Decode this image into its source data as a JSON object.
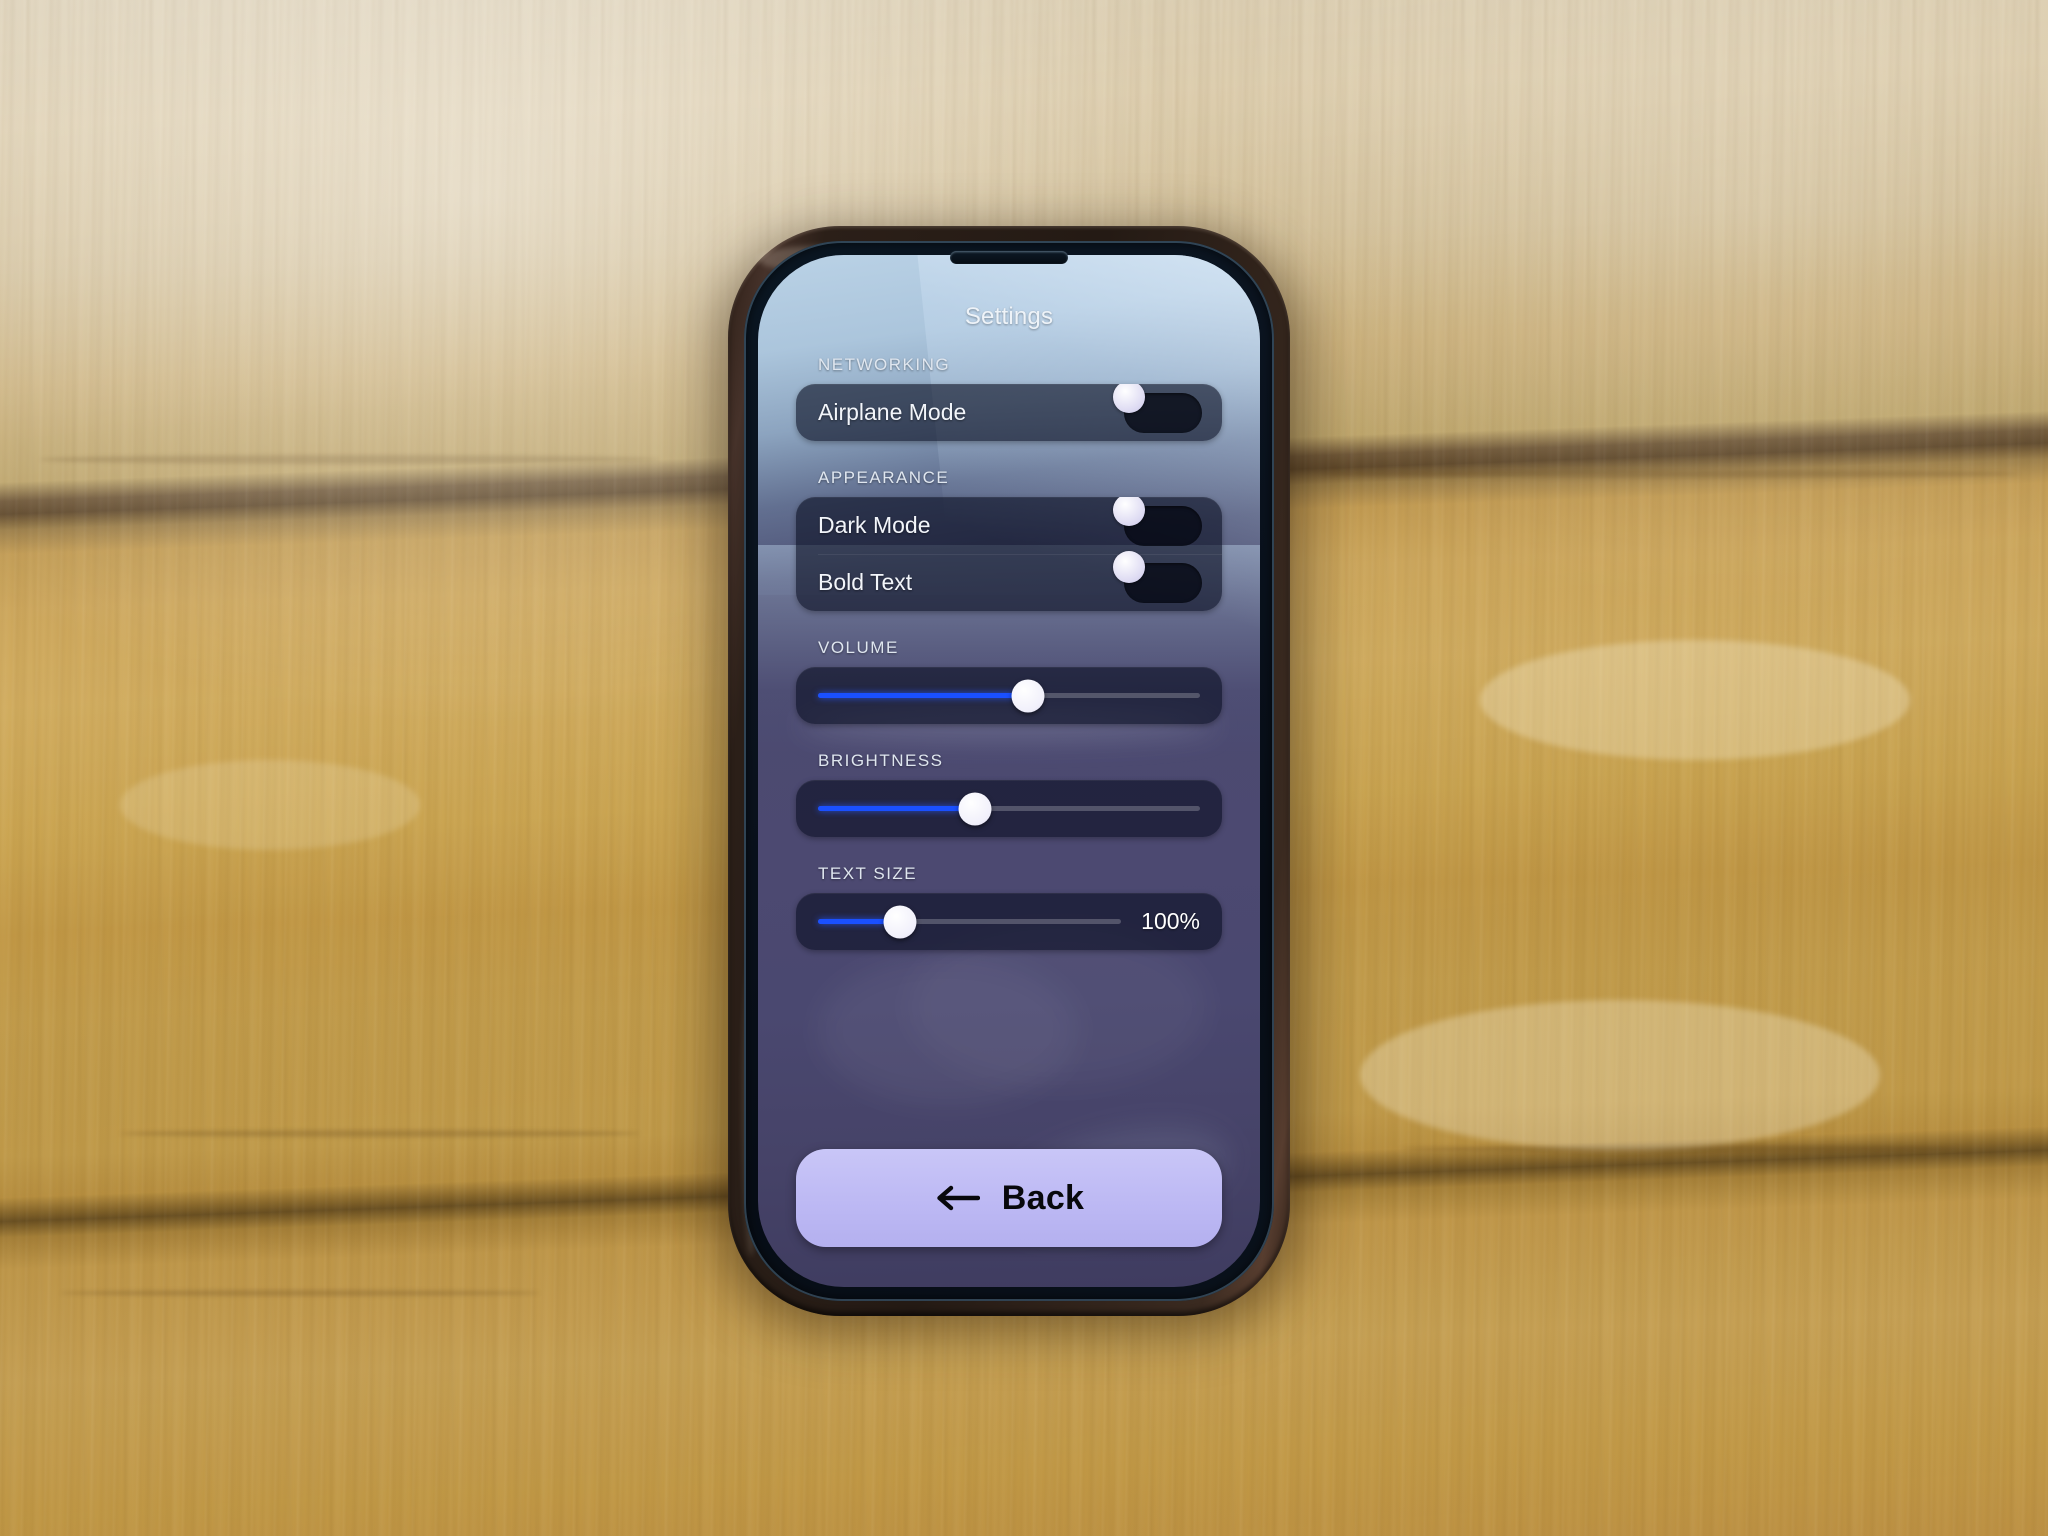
{
  "device": {
    "name": "smartphone-in-black-case-on-wooden-table",
    "surface": "wooden table"
  },
  "screen": {
    "title": "Settings",
    "sections": [
      {
        "id": "networking",
        "header": "NETWORKING",
        "rows": [
          {
            "label": "Airplane Mode",
            "control": "toggle",
            "state": "off"
          }
        ]
      },
      {
        "id": "appearance",
        "header": "APPEARANCE",
        "rows": [
          {
            "label": "Dark Mode",
            "control": "toggle",
            "state": "off"
          },
          {
            "label": "Bold Text",
            "control": "toggle",
            "state": "off"
          }
        ]
      },
      {
        "id": "volume",
        "header": "VOLUME",
        "slider": {
          "percent": 55,
          "value_label": ""
        }
      },
      {
        "id": "brightness",
        "header": "BRIGHTNESS",
        "slider": {
          "percent": 41,
          "value_label": ""
        }
      },
      {
        "id": "text-size",
        "header": "TEXT SIZE",
        "slider": {
          "percent": 27,
          "value_label": "100%"
        }
      }
    ],
    "back_button": {
      "label": "Back",
      "icon": "arrow-left-icon"
    }
  },
  "colors": {
    "accent_blue": "#1a50ff",
    "button_lavender": "#bdb9f4",
    "screen_bg": "#4a4870",
    "card_bg": "#0a0e22",
    "knob_white": "#ffffff",
    "text_primary": "#f2f5fa",
    "text_section": "#dfe6ef",
    "wood_light": "#d3bf96",
    "wood_gold": "#cba455",
    "case_black": "#2b1f18"
  }
}
